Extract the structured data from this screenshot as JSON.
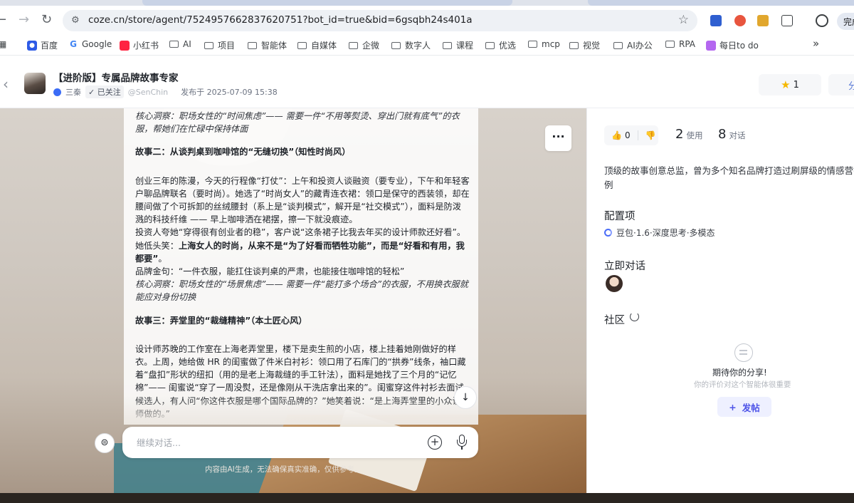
{
  "browser": {
    "url": "coze.cn/store/agent/7524957662837620751?bot_id=true&bid=6gsqbh24s401a",
    "done_label": "完成",
    "bookmarks": [
      "百度",
      "Google",
      "小红书",
      "AI",
      "项目",
      "智能体",
      "自媒体",
      "企微",
      "数字人",
      "课程",
      "优选",
      "mcp",
      "视觉",
      "AI办公",
      "RPA",
      "每日to do"
    ],
    "more_bookmarks": "»"
  },
  "agent": {
    "title": "【进阶版】专属品牌故事专家",
    "author": "三秦",
    "follow_label": "✓ 已关注",
    "handle": "@SenChin",
    "published": "发布于 2025-07-09 15:38",
    "favorites": "1",
    "share_label": "分"
  },
  "message": {
    "p1": "核心洞察：职场女性的“时间焦虑”—— 需要一件“不用等熨烫、穿出门就有底气”的衣服，帮她们在忙碌中保持体面",
    "h2": "故事二：从谈判桌到咖啡馆的“无缝切换”（知性时尚风）",
    "p2": "创业三年的陈漫，今天的行程像“打仗”：上午和投资人谈融资（要专业），下午和年轻客户聊品牌联名（要时尚）。她选了“时尚女人”的藏青连衣裙：领口是保守的西装领，却在腰间做了个可拆卸的丝绒腰封（系上是“谈判模式”，解开是“社交模式”），面料是防泼溅的科技纤维 —— 早上咖啡洒在裙摆，擦一下就没痕迹。",
    "p3a": "投资人夸她“穿得很有创业者的稳”，客户说“这条裙子比我去年买的设计师款还好看”。她低头笑：",
    "p3b": "上海女人的时尚，从来不是“为了好看而牺牲功能”，而是“好看和有用，我都要”",
    "p3c": "。",
    "p4": "品牌金句：“一件衣服，能扛住谈判桌的严肃，也能接住咖啡馆的轻松”",
    "p5": "核心洞察：职场女性的“场景焦虑”—— 需要一件“能打多个场合”的衣服，不用换衣服就能应对身份切换",
    "h3": "故事三：弄堂里的“裁缝精神”（本土匠心风）",
    "p6": "设计师苏晚的工作室在上海老弄堂里，楼下是卖生煎的小店，楼上挂着她刚做好的样衣。上周，她给做 HR 的闺蜜做了件米白衬衫：领口用了石库门的“拱券”线条，袖口藏着“盘扣”形状的纽扣（用的是老上海裁缝的手工针法），面料是她找了三个月的“记忆棉”—— 闺蜜说“穿了一周没熨，还是像刚从干洗店拿出来的”。闺蜜穿这件衬衫去面试候选人，有人问“你这件衣服是哪个国际品牌的？”她笑着说：“是上海弄堂里的小众设计师做的。”"
  },
  "chat": {
    "input_placeholder": "继续对话...",
    "disclaimer": "内容由AI生成，无法确保真实准确，仅供参考。"
  },
  "panel": {
    "likes": "0",
    "uses_num": "2",
    "uses_label": "使用",
    "dialogs_num": "8",
    "dialogs_label": "对话",
    "description": "顶级的故事创意总监，曾为多个知名品牌打造过刷屏级的情感营销案例",
    "config_title": "配置项",
    "config_value": "豆包·1.6·深度思考·多模态",
    "chat_now_title": "立即对话",
    "community_title": "社区",
    "empty_title": "期待你的分享!",
    "empty_subtitle": "你的评价对这个智能体很重要",
    "post_label": "发帖"
  },
  "colors": {
    "accent": "#4d53e8",
    "star": "#f5b800",
    "link_blue": "#3b6cf6"
  }
}
